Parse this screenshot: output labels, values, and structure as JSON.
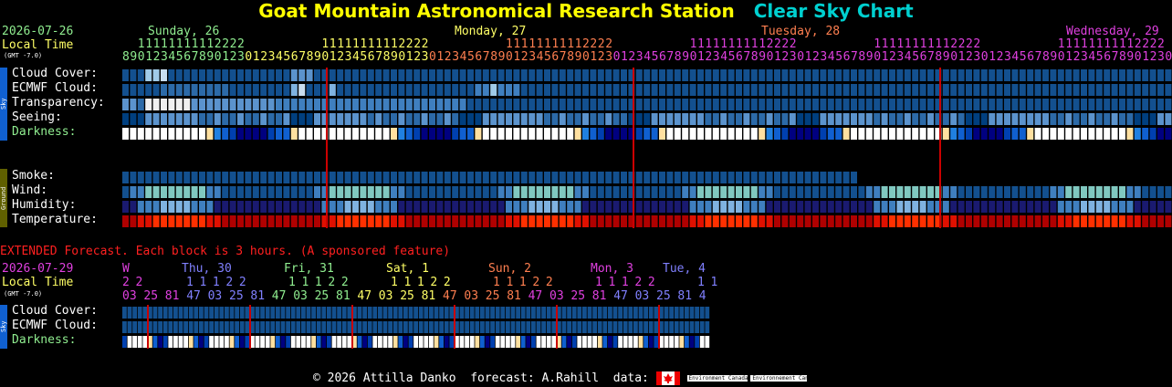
{
  "title": {
    "station": "Goat Mountain Astronomical Research Station",
    "chart": "Clear Sky Chart"
  },
  "main": {
    "date": "2026-07-26",
    "local_time": "Local Time",
    "gmt": "(GMT -7.0)",
    "days": [
      {
        "label": "Sunday, 26",
        "color": "#90ee90"
      },
      {
        "label": "Monday, 27",
        "color": "#ffff66"
      },
      {
        "label": "Tuesday, 28",
        "color": "#ff7f50"
      },
      {
        "label": "Wednesday, 29",
        "color": "#e040e0"
      }
    ],
    "hours_start": 8,
    "hours_count": 137,
    "sky_tag": "Sky",
    "ground_tag": "Ground",
    "rows": [
      {
        "key": "cloud",
        "label": "Cloud Cover:"
      },
      {
        "key": "ecmwf",
        "label": "ECMWF Cloud:"
      },
      {
        "key": "transp",
        "label": "Transparency:"
      },
      {
        "key": "seeing",
        "label": "Seeing:"
      },
      {
        "key": "dark",
        "label": "Darkness:"
      },
      {
        "key": "smoke",
        "label": "Smoke:"
      },
      {
        "key": "wind",
        "label": "Wind:"
      },
      {
        "key": "humid",
        "label": "Humidity:"
      },
      {
        "key": "temp",
        "label": "Temperature:"
      }
    ]
  },
  "extended": {
    "banner": "EXTENDED Forecast. Each block is 3 hours. (A sponsored feature)",
    "date": "2026-07-29",
    "local_time": "Local Time",
    "gmt": "(GMT -7.0)",
    "days": [
      {
        "label": "W",
        "color": "#e040e0"
      },
      {
        "label": "Thu, 30",
        "color": "#8080ff"
      },
      {
        "label": "Fri, 31",
        "color": "#90ee90"
      },
      {
        "label": "Sat, 1",
        "color": "#ffff66"
      },
      {
        "label": "Sun, 2",
        "color": "#ff7f50"
      },
      {
        "label": "Mon, 3",
        "color": "#e040e0"
      },
      {
        "label": "Tue, 4",
        "color": "#8080ff"
      }
    ],
    "hours": [
      "03",
      "25",
      "81",
      "47",
      "03",
      "25",
      "81",
      "47",
      "03",
      "25",
      "81",
      "47",
      "03",
      "25",
      "81",
      "47",
      "03",
      "25",
      "81",
      "47",
      "03",
      "25",
      "81",
      "47",
      "03",
      "25",
      "81",
      "4"
    ],
    "rows": [
      {
        "key": "cloud",
        "label": "Cloud Cover:"
      },
      {
        "key": "ecmwf",
        "label": "ECMWF Cloud:"
      },
      {
        "key": "dark",
        "label": "Darkness:"
      }
    ]
  },
  "footer": {
    "copyright": "© 2026 Attilla Danko",
    "forecast": "forecast: A.Rahill",
    "data": "data:",
    "agency_en": "Environment Canada",
    "agency_fr": "Environnement Canada"
  },
  "colors": {
    "title": "#ffff00",
    "chart_title": "#00d0d0",
    "cloud_clear": "#003f7f",
    "midnight_line": "#cc0000",
    "banner": "#ff2020",
    "darkness_label": "#90ee90"
  }
}
